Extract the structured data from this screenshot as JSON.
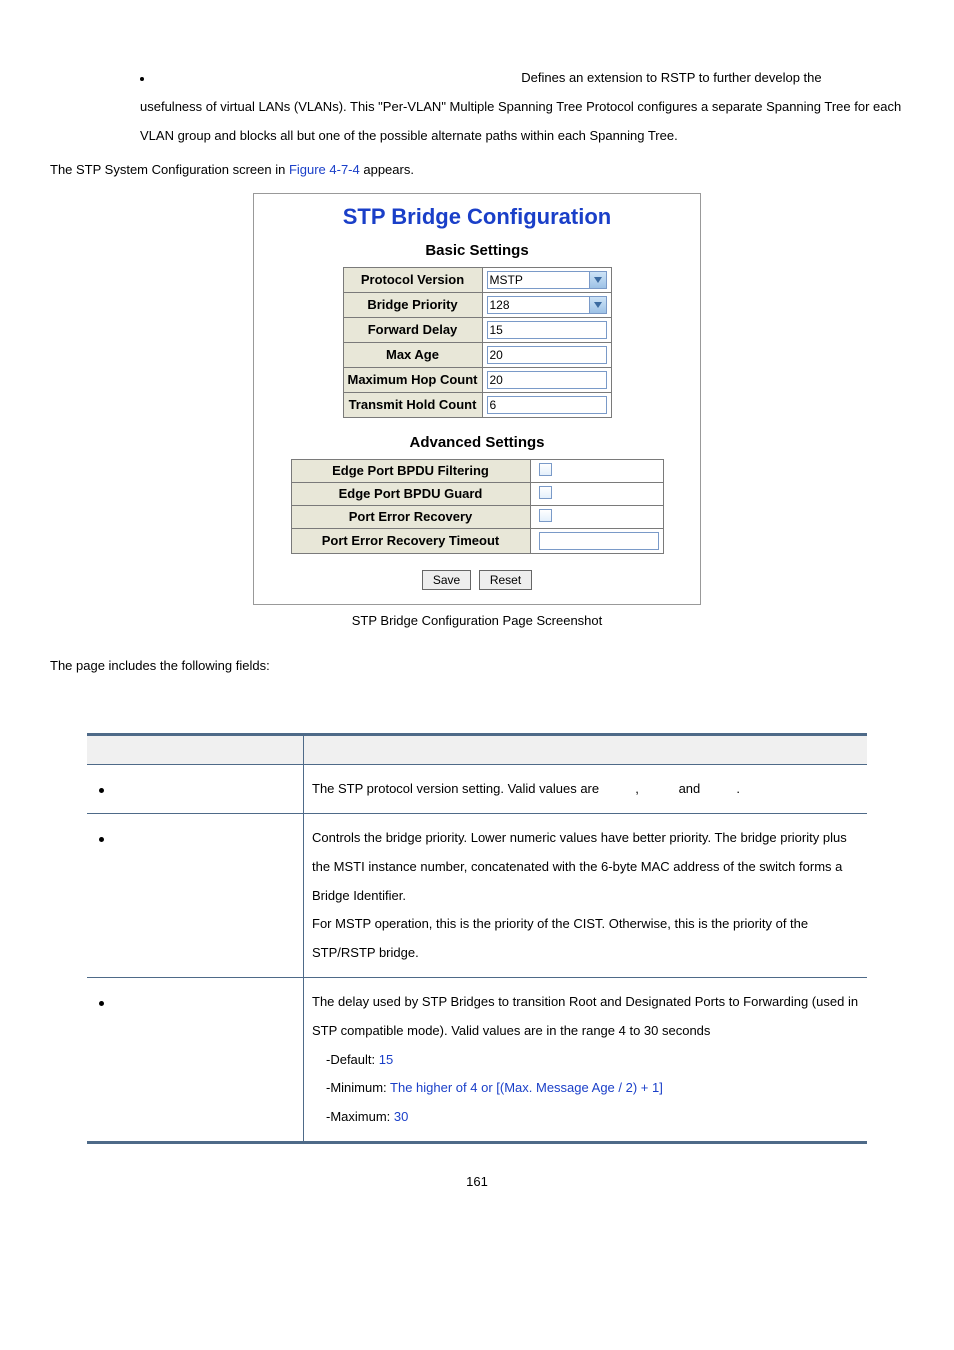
{
  "intro": {
    "line1_right": "Defines an extension to RSTP to further develop the",
    "para": "usefulness of virtual LANs (VLANs). This \"Per-VLAN\" Multiple Spanning Tree Protocol configures a separate Spanning Tree for each VLAN group and blocks all but one of the possible alternate paths within each Spanning Tree.",
    "outer_before": "The STP System Configuration screen in ",
    "outer_link": "Figure 4-7-4",
    "outer_after": " appears."
  },
  "config": {
    "title": "STP Bridge Configuration",
    "basic_title": "Basic Settings",
    "adv_title": "Advanced Settings",
    "rows": [
      {
        "label": "Protocol Version",
        "value": "MSTP",
        "type": "select"
      },
      {
        "label": "Bridge Priority",
        "value": "128",
        "type": "select"
      },
      {
        "label": "Forward Delay",
        "value": "15",
        "type": "text"
      },
      {
        "label": "Max Age",
        "value": "20",
        "type": "text"
      },
      {
        "label": "Maximum Hop Count",
        "value": "20",
        "type": "text"
      },
      {
        "label": "Transmit Hold Count",
        "value": "6",
        "type": "text"
      }
    ],
    "advrows": [
      {
        "label": "Edge Port BPDU Filtering",
        "type": "check"
      },
      {
        "label": "Edge Port BPDU Guard",
        "type": "check"
      },
      {
        "label": "Port Error Recovery",
        "type": "check"
      },
      {
        "label": "Port Error Recovery Timeout",
        "type": "text_empty"
      }
    ],
    "save": "Save",
    "reset": "Reset",
    "caption": "STP Bridge Configuration Page Screenshot"
  },
  "fields_intro": "The page includes the following fields:",
  "fields": [
    {
      "desc_parts": [
        "The STP protocol version setting. Valid values are ",
        "       ",
        ",            and",
        "           ."
      ]
    },
    {
      "desc_parts": [
        "Controls the bridge priority. Lower numeric values have better priority. The bridge priority plus the MSTI instance number, concatenated with the 6-byte MAC address of the switch forms a Bridge Identifier.",
        "For MSTP operation, this is the priority of the CIST. Otherwise, this is the priority of the STP/RSTP bridge."
      ]
    },
    {
      "desc_parts": [
        "The delay used by STP Bridges to transition Root and Designated Ports to Forwarding (used in STP compatible mode). Valid values are in the range 4 to 30 seconds"
      ],
      "defaults": [
        {
          "label": "-Default: ",
          "value": "15"
        },
        {
          "label": "-Minimum: ",
          "value": "The higher of 4 or [(Max. Message Age / 2) + 1]"
        },
        {
          "label": "-Maximum: ",
          "value": "30"
        }
      ]
    }
  ],
  "page_num": "161"
}
